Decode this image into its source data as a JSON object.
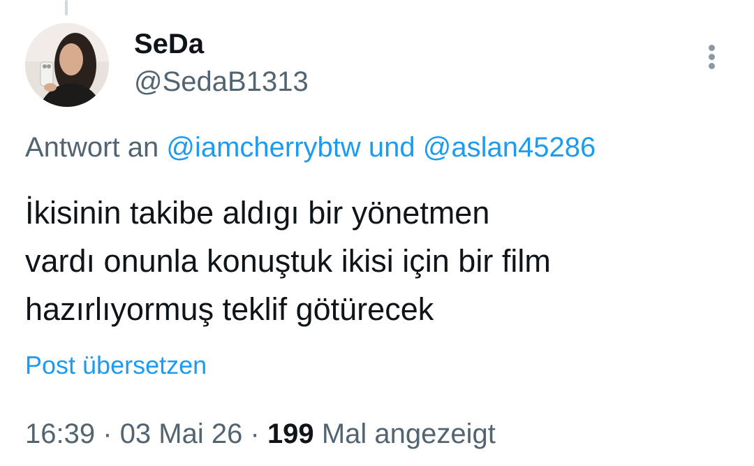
{
  "author": {
    "display_name": "SeDa",
    "handle": "@SedaB1313"
  },
  "reply": {
    "prefix": "Antwort an",
    "mention_1": "@iamcherrybtw",
    "conjunction": "und",
    "mention_2": "@aslan45286"
  },
  "tweet": {
    "lines": [
      "İkisinin takibe aldıgı bir yönetmen",
      "vardı onunla konuştuk ikisi için bir film",
      "hazırlıyormuş teklif götürecek"
    ],
    "translate_label": "Post übersetzen"
  },
  "meta": {
    "time": "16:39",
    "separator": "·",
    "date": "03 Mai 26",
    "views_count": "199",
    "views_label": "Mal angezeigt"
  },
  "icons": {
    "more": "more-vertical-icon"
  },
  "colors": {
    "accent": "#1d9bf0",
    "text_primary": "#0f1419",
    "text_secondary": "#536471"
  }
}
